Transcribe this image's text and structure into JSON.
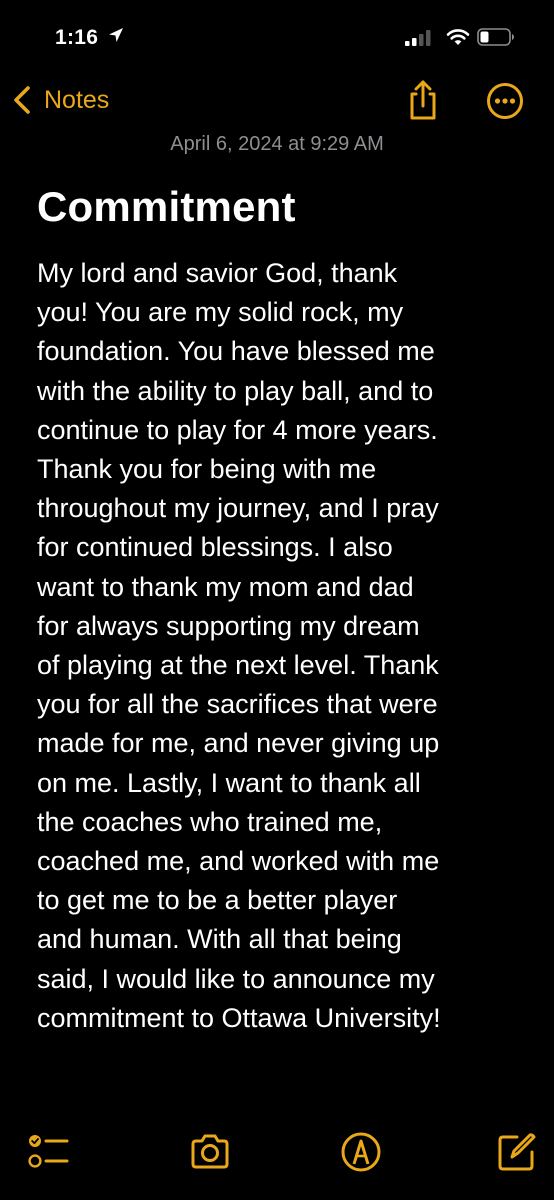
{
  "status_bar": {
    "time": "1:16"
  },
  "nav": {
    "back_label": "Notes"
  },
  "note": {
    "date": "April 6, 2024 at 9:29 AM",
    "title": "Commitment",
    "body": "My lord and savior God, thank\nyou! You are my solid rock, my\nfoundation. You have blessed me\nwith the ability to play ball, and to\ncontinue to play for 4 more years.\nThank you for being with me\nthroughout my journey, and I pray\nfor continued blessings. I also\nwant to thank my mom and dad\nfor always supporting my dream\nof playing at the next level. Thank\nyou for all the sacrifices that were\nmade for me, and never giving up\non me. Lastly, I want to thank all\nthe coaches who trained me,\ncoached me, and worked with me\nto get me to be a better player\nand human. With all that being\nsaid, I would like to announce my\ncommitment to Ottawa University!"
  },
  "toolbar": {
    "icons": [
      "checklist-icon",
      "camera-icon",
      "markup-icon",
      "compose-icon"
    ]
  },
  "colors": {
    "accent": "#e8a81a",
    "background": "#000000",
    "secondary_text": "#8e8e93"
  }
}
